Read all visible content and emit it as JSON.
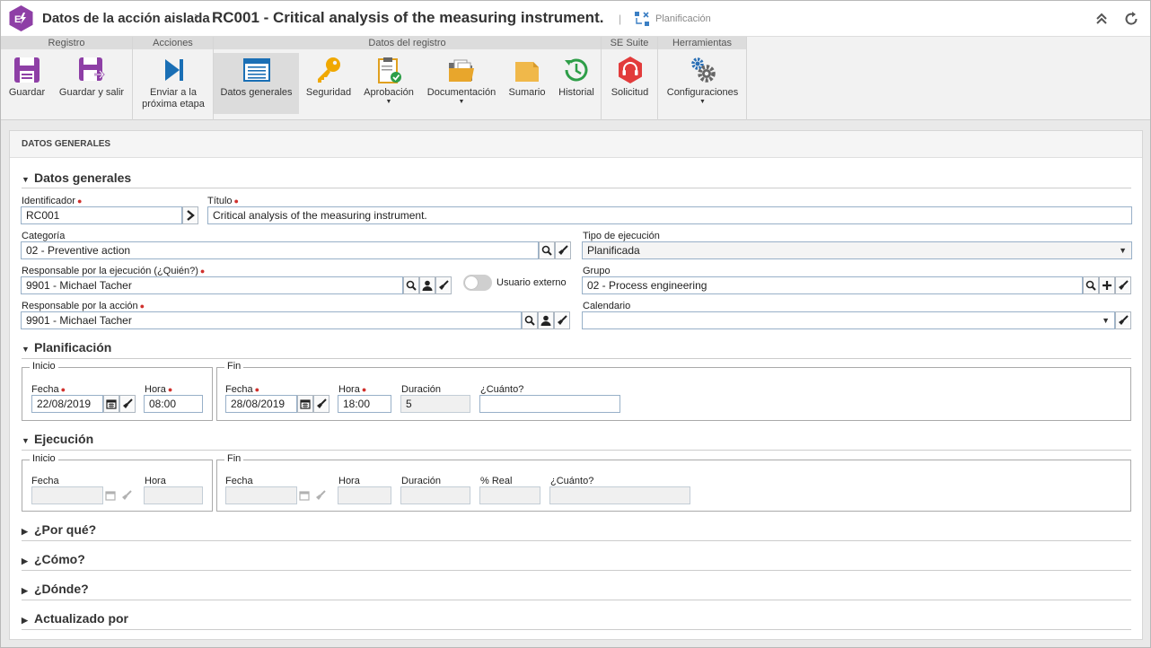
{
  "header": {
    "breadcrumb": "Datos de la acción aislada",
    "title": "RC001 - Critical analysis of the measuring instrument.",
    "status": "Planificación"
  },
  "ribbon": {
    "groups": {
      "registro": "Registro",
      "acciones": "Acciones",
      "datos_registro": "Datos del registro",
      "se_suite": "SE Suite",
      "herramientas": "Herramientas"
    },
    "buttons": {
      "guardar": "Guardar",
      "guardar_salir": "Guardar y salir",
      "enviar_1": "Enviar a la",
      "enviar_2": "próxima etapa",
      "datos_generales": "Datos generales",
      "seguridad": "Seguridad",
      "aprobacion": "Aprobación",
      "documentacion": "Documentación",
      "sumario": "Sumario",
      "historial": "Historial",
      "solicitud": "Solicitud",
      "configuraciones": "Configuraciones"
    }
  },
  "panel": {
    "header": "DATOS GENERALES",
    "sections": {
      "datos_generales": "Datos generales",
      "planificacion": "Planificación",
      "ejecucion": "Ejecución",
      "por_que": "¿Por qué?",
      "como": "¿Cómo?",
      "donde": "¿Dónde?",
      "actualizado_por": "Actualizado por"
    },
    "fields": {
      "identificador": {
        "label": "Identificador",
        "value": "RC001"
      },
      "titulo": {
        "label": "Título",
        "value": "Critical analysis of the measuring instrument."
      },
      "categoria": {
        "label": "Categoría",
        "value": "02 - Preventive action"
      },
      "tipo_ejecucion": {
        "label": "Tipo de ejecución",
        "value": "Planificada"
      },
      "responsable_ejecucion": {
        "label": "Responsable por la ejecución",
        "label_suffix": "(¿Quién?)",
        "value": "9901 - Michael Tacher"
      },
      "usuario_externo": {
        "label": "Usuario externo",
        "on": false
      },
      "grupo": {
        "label": "Grupo",
        "value": "02 - Process engineering"
      },
      "responsable_accion": {
        "label": "Responsable por la acción",
        "value": "9901 - Michael Tacher"
      },
      "calendario": {
        "label": "Calendario",
        "value": ""
      }
    },
    "planificacion": {
      "inicio": {
        "legend": "Inicio",
        "fecha_label": "Fecha",
        "fecha": "22/08/2019",
        "hora_label": "Hora",
        "hora": "08:00"
      },
      "fin": {
        "legend": "Fin",
        "fecha_label": "Fecha",
        "fecha": "28/08/2019",
        "hora_label": "Hora",
        "hora": "18:00",
        "duracion_label": "Duración",
        "duracion": "5",
        "cuanto_label": "¿Cuánto?",
        "cuanto": ""
      }
    },
    "ejecucion": {
      "inicio": {
        "legend": "Inicio",
        "fecha_label": "Fecha",
        "fecha": "",
        "hora_label": "Hora",
        "hora": ""
      },
      "fin": {
        "legend": "Fin",
        "fecha_label": "Fecha",
        "fecha": "",
        "hora_label": "Hora",
        "hora": "",
        "duracion_label": "Duración",
        "duracion": "",
        "real_label": "% Real",
        "real": "",
        "cuanto_label": "¿Cuánto?",
        "cuanto": ""
      }
    }
  },
  "colors": {
    "brand": "#8e3fa6",
    "required": "#d0312d",
    "field_border": "#98b0c8"
  }
}
